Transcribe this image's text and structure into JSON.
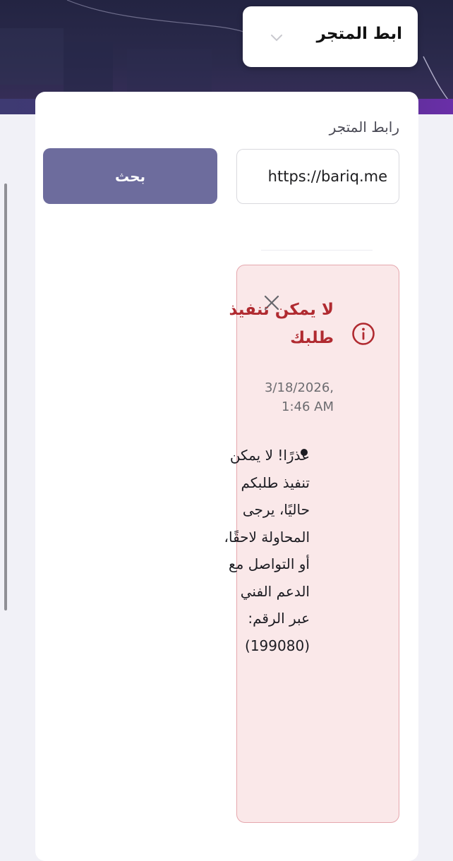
{
  "header": {
    "store_select_label": "ابط المتجر",
    "chevron_icon": "chevron-down-icon"
  },
  "form": {
    "field_label": "رابط المتجر",
    "url_value": "https://bariq.me",
    "search_button_label": "بحث"
  },
  "alert": {
    "title": "لا يمكن تنفيذ طلبك",
    "timestamp": "3/18/2026, 1:46 AM",
    "message": "عذرًا! لا يمكن تنفيذ طلبكم حاليًا، يرجى المحاولة لاحقًا، أو التواصل مع الدعم الفني عبر الرقم: (199080)",
    "icon": "info-icon",
    "close_icon": "close-icon"
  },
  "colors": {
    "primary_button": "#6d6c9d",
    "alert_background": "#fae8e9",
    "alert_border": "#e5a7ad",
    "alert_title": "#b02a30"
  }
}
